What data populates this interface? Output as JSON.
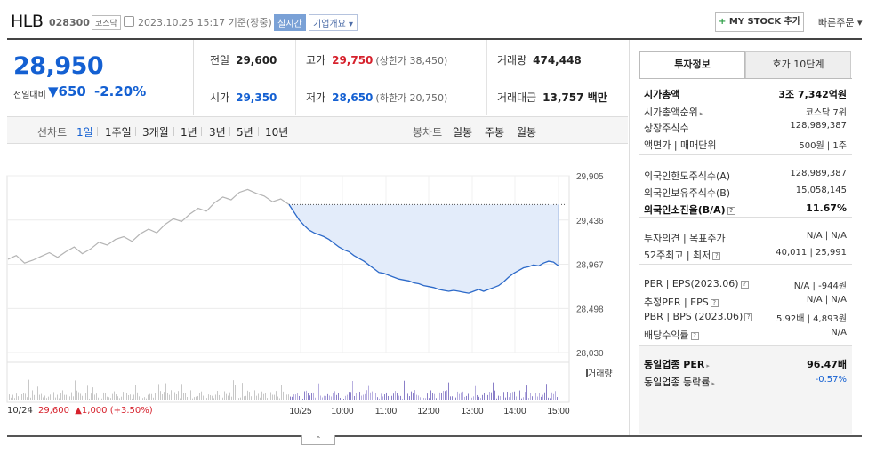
{
  "header": {
    "stock_name": "HLB",
    "stock_code": "028300",
    "market": "코스닥",
    "datetime": "2023.10.25 15:17 기준(장중)",
    "realtime_badge": "실시간",
    "company_overview": "기업개요",
    "my_stock_label": "MY STOCK 추가",
    "quick_order": "빠른주문"
  },
  "price": {
    "current": "28,950",
    "change_label": "전일대비",
    "change_value": "650",
    "change_pct": "-2.20%",
    "colors": {
      "down": "#1460d2",
      "up": "#d6212c"
    }
  },
  "quote": {
    "prev_label": "전일",
    "prev": "29,600",
    "high_label": "고가",
    "high": "29,750",
    "upper_limit": "(상한가 38,450)",
    "volume_label": "거래량",
    "volume": "474,448",
    "open_label": "시가",
    "open": "29,350",
    "low_label": "저가",
    "low": "28,650",
    "lower_limit": "(하한가 20,750)",
    "amount_label": "거래대금",
    "amount": "13,757 백만"
  },
  "tabs": {
    "line_label": "선차트",
    "line_periods": [
      "1일",
      "1주일",
      "3개월",
      "1년",
      "3년",
      "5년",
      "10년"
    ],
    "active_period": "1일",
    "candle_label": "봉차트",
    "candle_periods": [
      "일봉",
      "주봉",
      "월봉"
    ]
  },
  "chart_data": {
    "type": "line",
    "y_ticks": [
      "29,905",
      "29,436",
      "28,967",
      "28,498",
      "28,030"
    ],
    "ylim": [
      28030,
      29905
    ],
    "x_tick_labels": [
      "10/25",
      "10:00",
      "11:00",
      "12:00",
      "13:00",
      "14:00",
      "15:00"
    ],
    "volume_label": "거래량",
    "prev_close": 29600,
    "prev_day": {
      "date": "10/24",
      "close": "29,600",
      "change": "1,000",
      "change_pct": "(+3.50%)",
      "values": [
        29020,
        29060,
        28980,
        29010,
        29050,
        29090,
        29040,
        29100,
        29150,
        29080,
        29130,
        29200,
        29170,
        29230,
        29260,
        29210,
        29290,
        29340,
        29300,
        29390,
        29450,
        29420,
        29500,
        29560,
        29530,
        29620,
        29680,
        29650,
        29730,
        29760,
        29720,
        29690,
        29630,
        29660,
        29600
      ]
    },
    "today": {
      "values": [
        29600,
        29520,
        29440,
        29380,
        29330,
        29300,
        29280,
        29260,
        29230,
        29190,
        29150,
        29120,
        29100,
        29060,
        29030,
        29000,
        28960,
        28920,
        28880,
        28870,
        28850,
        28830,
        28810,
        28800,
        28790,
        28770,
        28760,
        28740,
        28730,
        28720,
        28700,
        28690,
        28680,
        28690,
        28680,
        28670,
        28660,
        28680,
        28700,
        28680,
        28700,
        28720,
        28740,
        28780,
        28830,
        28870,
        28900,
        28930,
        28940,
        28960,
        28950,
        28980,
        29000,
        28990,
        28950
      ]
    },
    "colors": {
      "prev": "#b4b4b4",
      "today": "#2d6ac9",
      "fill": "#e3ecfa"
    }
  },
  "invest": {
    "tab_active": "투자정보",
    "tab_other": "호가 10단계",
    "rows": [
      {
        "k": "시가총액",
        "v": "3조 7,342억원",
        "bold": true
      },
      {
        "k": "시가총액순위",
        "v": "코스닥 7위"
      },
      {
        "k": "상장주식수",
        "v": "128,989,387"
      },
      {
        "k": "액면가 | 매매단위",
        "v": "500원 | 1주"
      },
      {
        "k": "외국인한도주식수(A)",
        "v": "128,989,387"
      },
      {
        "k": "외국인보유주식수(B)",
        "v": "15,058,145"
      },
      {
        "k": "외국인소진율(B/A)",
        "v": "11.67%",
        "bold": true
      },
      {
        "k": "투자의견 | 목표주가",
        "v": "N/A | N/A"
      },
      {
        "k": "52주최고 | 최저",
        "v": "40,011 | 25,991"
      },
      {
        "k": "PER | EPS(2023.06)",
        "v": "N/A | -944원"
      },
      {
        "k": "추정PER | EPS",
        "v": "N/A | N/A"
      },
      {
        "k": "PBR | BPS (2023.06)",
        "v": "5.92배 | 4,893원"
      },
      {
        "k": "배당수익률",
        "v": "N/A"
      },
      {
        "k": "동일업종 PER",
        "v": "96.47배",
        "bold": true
      },
      {
        "k": "동일업종 등락률",
        "v": "-0.57%",
        "blue": true
      }
    ]
  }
}
